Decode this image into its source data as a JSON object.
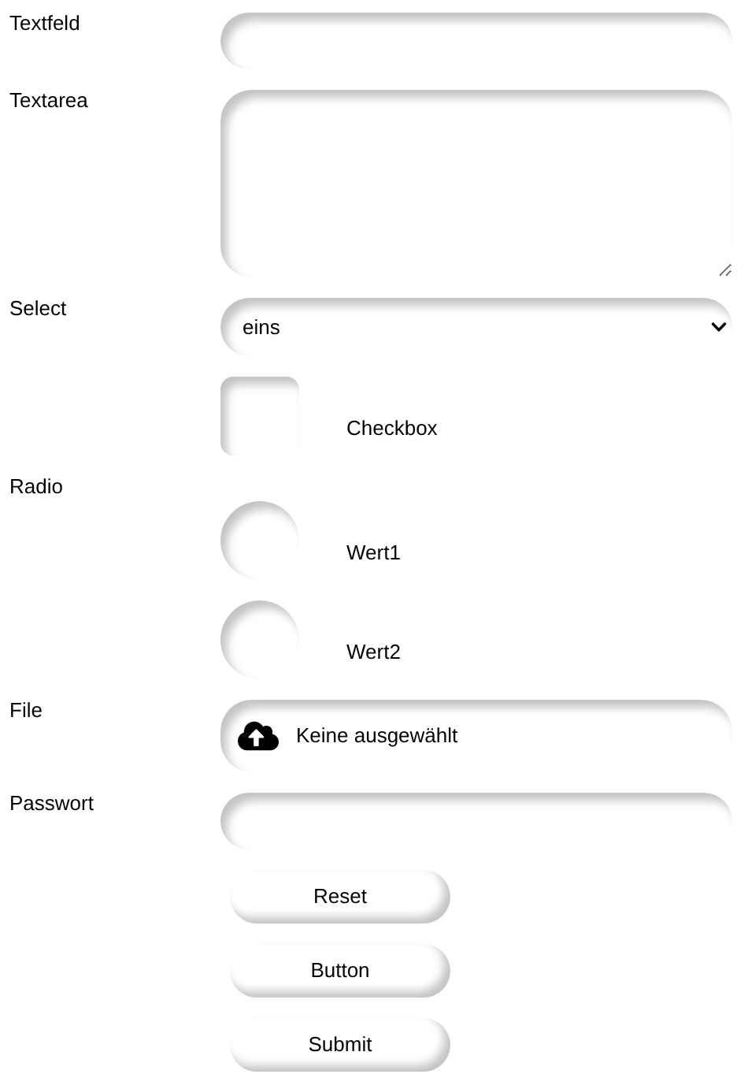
{
  "fields": [
    {
      "kind": "text",
      "label": "Textfeld"
    },
    {
      "kind": "textarea",
      "label": "Textarea"
    },
    {
      "kind": "select",
      "label": "Select",
      "value": "eins"
    },
    {
      "kind": "checkbox",
      "text": "Checkbox",
      "checked": false
    },
    {
      "kind": "radio",
      "label": "Radio",
      "options": [
        {
          "text": "Wert1",
          "selected": false
        },
        {
          "text": "Wert2",
          "selected": false
        }
      ]
    },
    {
      "kind": "file",
      "label": "File",
      "value": "Keine ausgewählt"
    },
    {
      "kind": "password",
      "label": "Passwort"
    }
  ],
  "buttons": [
    "Reset",
    "Button",
    "Submit"
  ]
}
